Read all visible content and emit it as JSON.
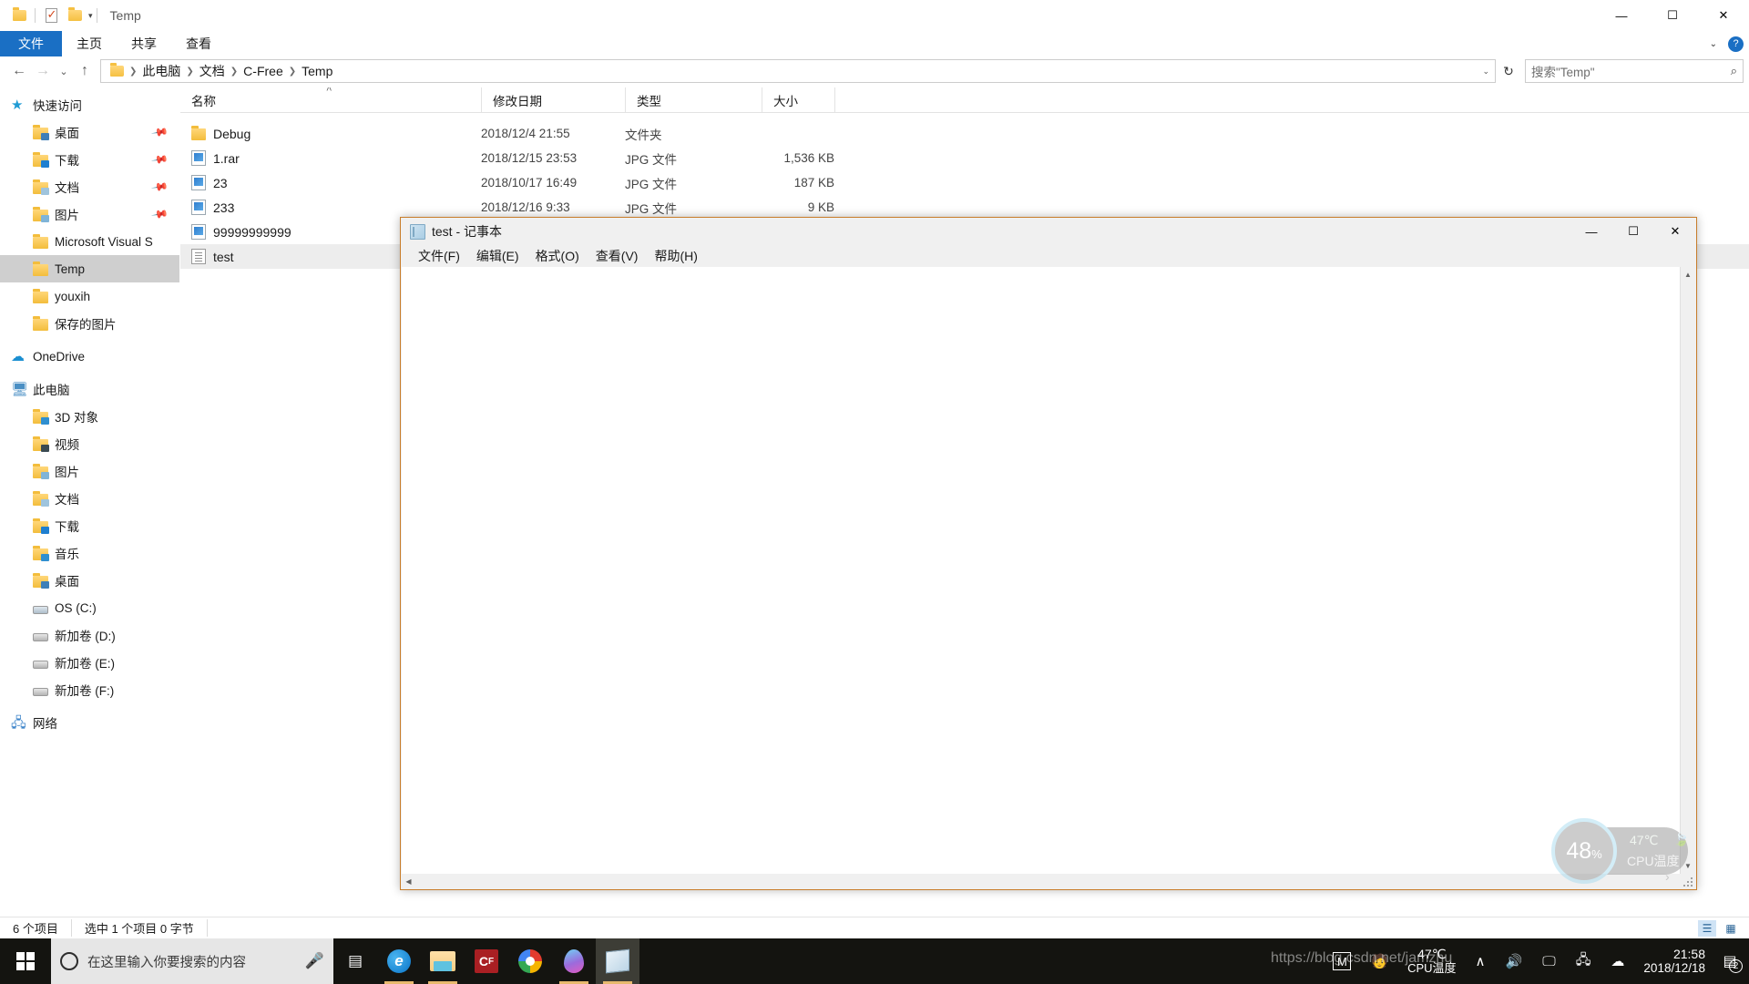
{
  "explorer": {
    "window_title": "Temp",
    "quick_access_toolbar": [
      "folder-icon",
      "properties-icon",
      "new-folder-icon",
      "customize-chevron"
    ],
    "window_controls": {
      "minimize": "—",
      "maximize": "☐",
      "close": "✕"
    },
    "ribbon_tabs": [
      {
        "label": "文件",
        "active": true
      },
      {
        "label": "主页",
        "active": false
      },
      {
        "label": "共享",
        "active": false
      },
      {
        "label": "查看",
        "active": false
      }
    ],
    "ribbon_right": {
      "collapse": "⌄",
      "help": "?"
    },
    "nav_buttons": {
      "back": "←",
      "forward": "→",
      "recent": "⌄",
      "up": "↑"
    },
    "breadcrumb": [
      "此电脑",
      "文档",
      "C-Free",
      "Temp"
    ],
    "address_caret": "⌄",
    "refresh": "↻",
    "search": {
      "placeholder": "搜索\"Temp\"",
      "icon": "⌕"
    },
    "nav_pane": [
      {
        "label": "快速访问",
        "icon": "star-icon",
        "level": 0,
        "pinned": false,
        "selected": false
      },
      {
        "label": "桌面",
        "icon": "folder-desktop-icon",
        "level": 1,
        "pinned": true,
        "selected": false
      },
      {
        "label": "下载",
        "icon": "folder-downloads-icon",
        "level": 1,
        "pinned": true,
        "selected": false
      },
      {
        "label": "文档",
        "icon": "folder-documents-icon",
        "level": 1,
        "pinned": true,
        "selected": false
      },
      {
        "label": "图片",
        "icon": "folder-pictures-icon",
        "level": 1,
        "pinned": true,
        "selected": false
      },
      {
        "label": "Microsoft Visual S",
        "icon": "folder-icon",
        "level": 1,
        "pinned": false,
        "selected": false
      },
      {
        "label": "Temp",
        "icon": "folder-icon",
        "level": 1,
        "pinned": false,
        "selected": true
      },
      {
        "label": "youxih",
        "icon": "folder-icon",
        "level": 1,
        "pinned": false,
        "selected": false
      },
      {
        "label": "保存的图片",
        "icon": "folder-icon",
        "level": 1,
        "pinned": false,
        "selected": false
      },
      {
        "label": "OneDrive",
        "icon": "cloud-icon",
        "level": 0,
        "pinned": false,
        "selected": false
      },
      {
        "label": "此电脑",
        "icon": "computer-icon",
        "level": 0,
        "pinned": false,
        "selected": false
      },
      {
        "label": "3D 对象",
        "icon": "folder-3d-icon",
        "level": 1,
        "pinned": false,
        "selected": false
      },
      {
        "label": "视频",
        "icon": "folder-videos-icon",
        "level": 1,
        "pinned": false,
        "selected": false
      },
      {
        "label": "图片",
        "icon": "folder-pictures-icon",
        "level": 1,
        "pinned": false,
        "selected": false
      },
      {
        "label": "文档",
        "icon": "folder-documents-icon",
        "level": 1,
        "pinned": false,
        "selected": false
      },
      {
        "label": "下载",
        "icon": "folder-downloads-icon",
        "level": 1,
        "pinned": false,
        "selected": false
      },
      {
        "label": "音乐",
        "icon": "folder-music-icon",
        "level": 1,
        "pinned": false,
        "selected": false
      },
      {
        "label": "桌面",
        "icon": "folder-desktop-icon",
        "level": 1,
        "pinned": false,
        "selected": false
      },
      {
        "label": "OS (C:)",
        "icon": "drive-os-icon",
        "level": 1,
        "pinned": false,
        "selected": false
      },
      {
        "label": "新加卷 (D:)",
        "icon": "drive-icon",
        "level": 1,
        "pinned": false,
        "selected": false
      },
      {
        "label": "新加卷 (E:)",
        "icon": "drive-icon",
        "level": 1,
        "pinned": false,
        "selected": false
      },
      {
        "label": "新加卷 (F:)",
        "icon": "drive-icon",
        "level": 1,
        "pinned": false,
        "selected": false
      },
      {
        "label": "网络",
        "icon": "network-icon",
        "level": 0,
        "pinned": false,
        "selected": false
      }
    ],
    "columns": [
      {
        "key": "name",
        "label": "名称",
        "sorted": true
      },
      {
        "key": "date",
        "label": "修改日期",
        "sorted": false
      },
      {
        "key": "type",
        "label": "类型",
        "sorted": false
      },
      {
        "key": "size",
        "label": "大小",
        "sorted": false
      }
    ],
    "sort_indicator": "˄",
    "files": [
      {
        "name": "Debug",
        "date": "2018/12/4 21:55",
        "type": "文件夹",
        "size": "",
        "icon": "folder-icon",
        "selected": false
      },
      {
        "name": "1.rar",
        "date": "2018/12/15 23:53",
        "type": "JPG 文件",
        "size": "1,536 KB",
        "icon": "jpg-file-icon",
        "selected": false
      },
      {
        "name": "23",
        "date": "2018/10/17 16:49",
        "type": "JPG 文件",
        "size": "187 KB",
        "icon": "jpg-file-icon",
        "selected": false
      },
      {
        "name": "233",
        "date": "2018/12/16 9:33",
        "type": "JPG 文件",
        "size": "9 KB",
        "icon": "jpg-file-icon",
        "selected": false
      },
      {
        "name": "99999999999",
        "date": "",
        "type": "",
        "size": "",
        "icon": "jpg-file-icon",
        "selected": false
      },
      {
        "name": "test",
        "date": "",
        "type": "",
        "size": "",
        "icon": "text-file-icon",
        "selected": true
      }
    ],
    "status": {
      "item_count": "6 个项目",
      "selection": "选中 1 个项目  0 字节"
    },
    "view_buttons": [
      {
        "name": "details-view",
        "glyph": "☰",
        "active": true
      },
      {
        "name": "large-icons-view",
        "glyph": "▦",
        "active": false
      }
    ]
  },
  "notepad": {
    "title": "test - 记事本",
    "icon": "notepad-icon",
    "window_controls": {
      "minimize": "—",
      "maximize": "☐",
      "close": "✕"
    },
    "menu": [
      "文件(F)",
      "编辑(E)",
      "格式(O)",
      "查看(V)",
      "帮助(H)"
    ],
    "content": "",
    "scroll": {
      "up": "▲",
      "down": "▼",
      "left": "◀",
      "right": "▶"
    }
  },
  "cpu_widget": {
    "percent": "48",
    "percent_unit": "%",
    "temp": "47℃",
    "label": "CPU温度",
    "leaf_icon": "leaf-icon",
    "expand_arrow": "›",
    "ring_color": "#9fd8ee"
  },
  "taskbar": {
    "start": "windows-logo-icon",
    "search_placeholder": "在这里输入你要搜索的内容",
    "search_icons": {
      "cortana": "cortana-circle-icon",
      "mic": "🎙"
    },
    "buttons": [
      {
        "name": "task-view-button",
        "icon": "task-view-icon",
        "running": false,
        "active": false
      },
      {
        "name": "edge-button",
        "icon": "edge-icon",
        "running": true,
        "active": false
      },
      {
        "name": "explorer-button",
        "icon": "file-explorer-icon",
        "running": true,
        "active": false
      },
      {
        "name": "cfree-button",
        "icon": "c-free-icon",
        "running": false,
        "active": false
      },
      {
        "name": "chrome-button",
        "icon": "chrome-icon",
        "running": false,
        "active": false
      },
      {
        "name": "drop-app-button",
        "icon": "droplet-icon",
        "running": true,
        "active": false
      },
      {
        "name": "notepad-button",
        "icon": "notepad-icon",
        "running": true,
        "active": true
      }
    ],
    "tray": {
      "m_icon": "M",
      "people_icon": "people-icon",
      "cpu_temp": "47℃",
      "cpu_label": "CPU温度",
      "chevron": "∧",
      "volume_icon": "speaker-icon",
      "display_icon": "display-icon",
      "network_icon": "network-icon",
      "onedrive_icon": "onedrive-icon",
      "time": "21:58",
      "date": "2018/12/18",
      "notification_icon": "notification-icon",
      "notification_count": "2"
    }
  },
  "watermark": "https://blog.csdn.net/jamzhu"
}
